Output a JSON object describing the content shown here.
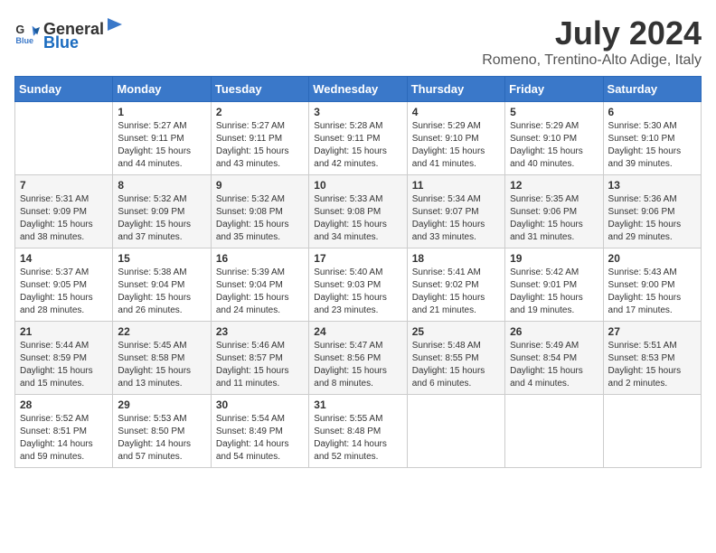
{
  "header": {
    "logo_general": "General",
    "logo_blue": "Blue",
    "month_year": "July 2024",
    "location": "Romeno, Trentino-Alto Adige, Italy"
  },
  "days_of_week": [
    "Sunday",
    "Monday",
    "Tuesday",
    "Wednesday",
    "Thursday",
    "Friday",
    "Saturday"
  ],
  "weeks": [
    [
      {
        "day": "",
        "info": ""
      },
      {
        "day": "1",
        "info": "Sunrise: 5:27 AM\nSunset: 9:11 PM\nDaylight: 15 hours\nand 44 minutes."
      },
      {
        "day": "2",
        "info": "Sunrise: 5:27 AM\nSunset: 9:11 PM\nDaylight: 15 hours\nand 43 minutes."
      },
      {
        "day": "3",
        "info": "Sunrise: 5:28 AM\nSunset: 9:11 PM\nDaylight: 15 hours\nand 42 minutes."
      },
      {
        "day": "4",
        "info": "Sunrise: 5:29 AM\nSunset: 9:10 PM\nDaylight: 15 hours\nand 41 minutes."
      },
      {
        "day": "5",
        "info": "Sunrise: 5:29 AM\nSunset: 9:10 PM\nDaylight: 15 hours\nand 40 minutes."
      },
      {
        "day": "6",
        "info": "Sunrise: 5:30 AM\nSunset: 9:10 PM\nDaylight: 15 hours\nand 39 minutes."
      }
    ],
    [
      {
        "day": "7",
        "info": "Sunrise: 5:31 AM\nSunset: 9:09 PM\nDaylight: 15 hours\nand 38 minutes."
      },
      {
        "day": "8",
        "info": "Sunrise: 5:32 AM\nSunset: 9:09 PM\nDaylight: 15 hours\nand 37 minutes."
      },
      {
        "day": "9",
        "info": "Sunrise: 5:32 AM\nSunset: 9:08 PM\nDaylight: 15 hours\nand 35 minutes."
      },
      {
        "day": "10",
        "info": "Sunrise: 5:33 AM\nSunset: 9:08 PM\nDaylight: 15 hours\nand 34 minutes."
      },
      {
        "day": "11",
        "info": "Sunrise: 5:34 AM\nSunset: 9:07 PM\nDaylight: 15 hours\nand 33 minutes."
      },
      {
        "day": "12",
        "info": "Sunrise: 5:35 AM\nSunset: 9:06 PM\nDaylight: 15 hours\nand 31 minutes."
      },
      {
        "day": "13",
        "info": "Sunrise: 5:36 AM\nSunset: 9:06 PM\nDaylight: 15 hours\nand 29 minutes."
      }
    ],
    [
      {
        "day": "14",
        "info": "Sunrise: 5:37 AM\nSunset: 9:05 PM\nDaylight: 15 hours\nand 28 minutes."
      },
      {
        "day": "15",
        "info": "Sunrise: 5:38 AM\nSunset: 9:04 PM\nDaylight: 15 hours\nand 26 minutes."
      },
      {
        "day": "16",
        "info": "Sunrise: 5:39 AM\nSunset: 9:04 PM\nDaylight: 15 hours\nand 24 minutes."
      },
      {
        "day": "17",
        "info": "Sunrise: 5:40 AM\nSunset: 9:03 PM\nDaylight: 15 hours\nand 23 minutes."
      },
      {
        "day": "18",
        "info": "Sunrise: 5:41 AM\nSunset: 9:02 PM\nDaylight: 15 hours\nand 21 minutes."
      },
      {
        "day": "19",
        "info": "Sunrise: 5:42 AM\nSunset: 9:01 PM\nDaylight: 15 hours\nand 19 minutes."
      },
      {
        "day": "20",
        "info": "Sunrise: 5:43 AM\nSunset: 9:00 PM\nDaylight: 15 hours\nand 17 minutes."
      }
    ],
    [
      {
        "day": "21",
        "info": "Sunrise: 5:44 AM\nSunset: 8:59 PM\nDaylight: 15 hours\nand 15 minutes."
      },
      {
        "day": "22",
        "info": "Sunrise: 5:45 AM\nSunset: 8:58 PM\nDaylight: 15 hours\nand 13 minutes."
      },
      {
        "day": "23",
        "info": "Sunrise: 5:46 AM\nSunset: 8:57 PM\nDaylight: 15 hours\nand 11 minutes."
      },
      {
        "day": "24",
        "info": "Sunrise: 5:47 AM\nSunset: 8:56 PM\nDaylight: 15 hours\nand 8 minutes."
      },
      {
        "day": "25",
        "info": "Sunrise: 5:48 AM\nSunset: 8:55 PM\nDaylight: 15 hours\nand 6 minutes."
      },
      {
        "day": "26",
        "info": "Sunrise: 5:49 AM\nSunset: 8:54 PM\nDaylight: 15 hours\nand 4 minutes."
      },
      {
        "day": "27",
        "info": "Sunrise: 5:51 AM\nSunset: 8:53 PM\nDaylight: 15 hours\nand 2 minutes."
      }
    ],
    [
      {
        "day": "28",
        "info": "Sunrise: 5:52 AM\nSunset: 8:51 PM\nDaylight: 14 hours\nand 59 minutes."
      },
      {
        "day": "29",
        "info": "Sunrise: 5:53 AM\nSunset: 8:50 PM\nDaylight: 14 hours\nand 57 minutes."
      },
      {
        "day": "30",
        "info": "Sunrise: 5:54 AM\nSunset: 8:49 PM\nDaylight: 14 hours\nand 54 minutes."
      },
      {
        "day": "31",
        "info": "Sunrise: 5:55 AM\nSunset: 8:48 PM\nDaylight: 14 hours\nand 52 minutes."
      },
      {
        "day": "",
        "info": ""
      },
      {
        "day": "",
        "info": ""
      },
      {
        "day": "",
        "info": ""
      }
    ]
  ]
}
